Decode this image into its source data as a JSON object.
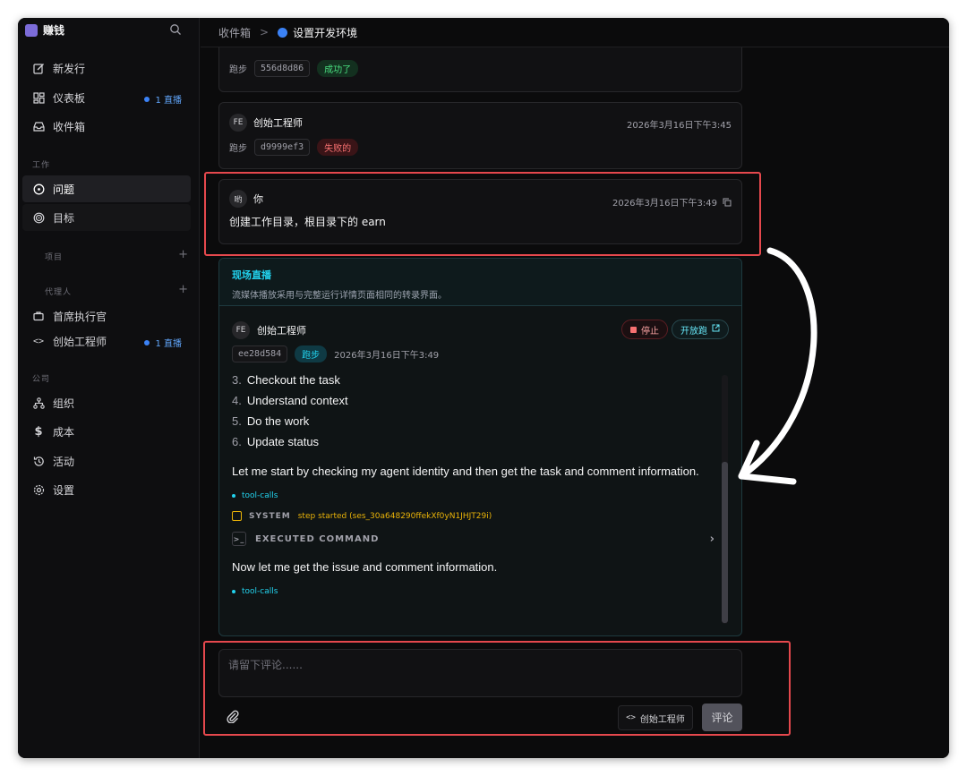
{
  "app": {
    "name": "赚钱"
  },
  "sidebar": {
    "top_items": [
      {
        "label": "新发行",
        "icon": "edit-icon"
      },
      {
        "label": "仪表板",
        "icon": "dashboard-icon",
        "badge": "1 直播"
      },
      {
        "label": "收件箱",
        "icon": "inbox-icon"
      }
    ],
    "work_section": "工作",
    "work_items": [
      {
        "label": "问题",
        "icon": "circle-dot-icon"
      },
      {
        "label": "目标",
        "icon": "target-icon"
      }
    ],
    "projects_label": "项目",
    "agents_label": "代理人",
    "agents": [
      {
        "label": "首席执行官",
        "icon": "briefcase-icon"
      },
      {
        "label": "创始工程师",
        "icon": "code-icon",
        "badge": "1 直播"
      }
    ],
    "company_section": "公司",
    "company_items": [
      {
        "label": "组织",
        "icon": "org-icon"
      },
      {
        "label": "成本",
        "icon": "dollar-icon"
      },
      {
        "label": "活动",
        "icon": "history-icon"
      },
      {
        "label": "设置",
        "icon": "gear-icon"
      }
    ]
  },
  "breadcrumb": {
    "parent": "收件箱",
    "separator": ">",
    "current": "设置开发环境"
  },
  "runs": [
    {
      "run_label": "跑步",
      "hash": "556d8d86",
      "status": "成功了"
    },
    {
      "avatar": "FE",
      "author": "创始工程师",
      "time": "2026年3月16日下午3:45",
      "run_label": "跑步",
      "hash": "d9999ef3",
      "status": "失败的"
    }
  ],
  "user_comment": {
    "avatar": "哟",
    "author": "你",
    "time": "2026年3月16日下午3:49",
    "body": "创建工作目录，根目录下的 earn"
  },
  "live": {
    "title": "现场直播",
    "description": "流媒体播放采用与完整运行详情页面相同的转录界面。",
    "run": {
      "avatar": "FE",
      "author": "创始工程师",
      "hash": "ee28d584",
      "status": "跑步",
      "time": "2026年3月16日下午3:49",
      "stop_label": "停止",
      "open_label": "开放跑"
    },
    "transcript": {
      "list": [
        {
          "num": "3.",
          "text": "Checkout the task"
        },
        {
          "num": "4.",
          "text": "Understand context"
        },
        {
          "num": "5.",
          "text": "Do the work"
        },
        {
          "num": "6.",
          "text": "Update status"
        }
      ],
      "para1": "Let me start by checking my agent identity and then get the task and comment information.",
      "tool1": "tool-calls",
      "system_label": "SYSTEM",
      "system_text": "step started (ses_30a648290ffekXf0yN1JHJT29i)",
      "exec_label": "EXECUTED COMMAND",
      "para2": "Now let me get the issue and comment information.",
      "tool2": "tool-calls"
    }
  },
  "composer": {
    "placeholder": "请留下评论......",
    "agent": "创始工程师",
    "submit": "评论"
  }
}
